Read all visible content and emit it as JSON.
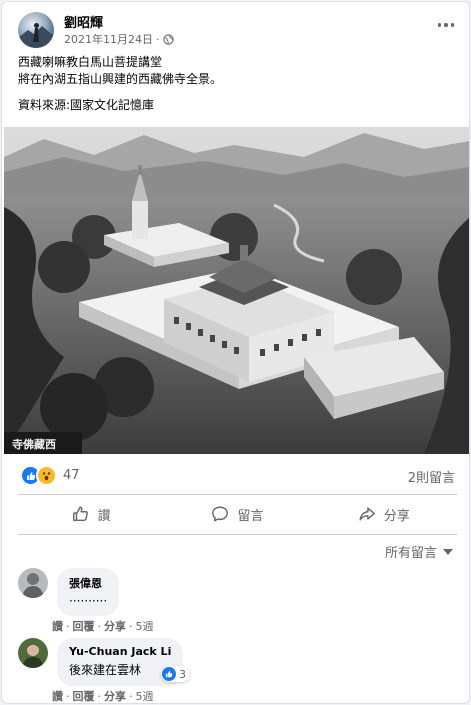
{
  "post": {
    "author": "劉昭輝",
    "date": "2021年11月24日",
    "separator": "·",
    "line1": "西藏喇嘛教白馬山菩提講堂",
    "line2": "將在內湖五指山興建的西藏佛寺全景。",
    "line3": "資料來源:國家文化記憶庫",
    "image_caption": "寺佛藏西"
  },
  "engagement": {
    "reaction_count": "47",
    "comment_count": "2則留言"
  },
  "actions": {
    "like": "讚",
    "comment": "留言",
    "share": "分享"
  },
  "comments_sort": "所有留言",
  "comments": [
    {
      "name": "張偉恩",
      "text": "··········",
      "like": "讚",
      "reply": "回覆",
      "share": "分享",
      "time": "5週"
    },
    {
      "name": "Yu-Chuan Jack Li",
      "text": "後來建在雲林",
      "reactions": "3",
      "like": "讚",
      "reply": "回覆",
      "share": "分享",
      "time": "5週"
    }
  ],
  "icons": [
    "globe-icon",
    "more-options-icon",
    "like-reaction-icon",
    "wow-reaction-icon",
    "like-outline-icon",
    "comment-outline-icon",
    "share-outline-icon",
    "dropdown-caret-icon"
  ],
  "colors": {
    "brand_blue": "#1877f2",
    "wow_yellow": "#f7b928",
    "secondary_text": "#65676b",
    "bubble_bg": "#f0f2f5"
  }
}
